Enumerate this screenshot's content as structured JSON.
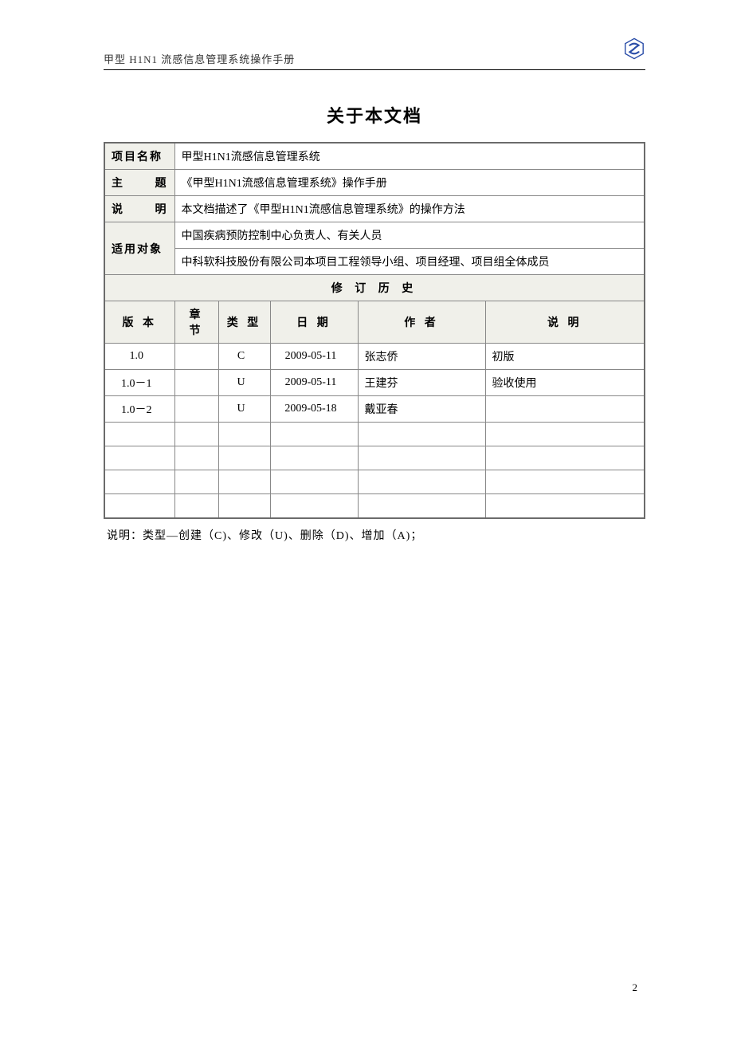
{
  "header": {
    "title": "甲型 H1N1 流感信息管理系统操作手册"
  },
  "doc_title": "关于本文档",
  "meta": {
    "project_name_label": "项目名称",
    "project_name": "甲型H1N1流感信息管理系统",
    "subject_label": "主　　题",
    "subject": "《甲型H1N1流感信息管理系统》操作手册",
    "description_label": "说　　明",
    "description": "本文档描述了《甲型H1N1流感信息管理系统》的操作方法",
    "audience_label": "适用对象",
    "audience_line1": "中国疾病预防控制中心负责人、有关人员",
    "audience_line2": "中科软科技股份有限公司本项目工程领导小组、项目经理、项目组全体成员"
  },
  "revision": {
    "title": "修 订 历 史",
    "columns": {
      "version": "版 本",
      "chapter": "章 节",
      "type": "类 型",
      "date": "日 期",
      "author": "作 者",
      "note": "说 明"
    },
    "rows": [
      {
        "version": "1.0",
        "chapter": "",
        "type": "C",
        "date": "2009-05-11",
        "author": "张志侨",
        "note": "初版"
      },
      {
        "version": "1.0－1",
        "chapter": "",
        "type": "U",
        "date": "2009-05-11",
        "author": "王建芬",
        "note": "验收使用"
      },
      {
        "version": "1.0－2",
        "chapter": "",
        "type": "U",
        "date": "2009-05-18",
        "author": "戴亚春",
        "note": ""
      },
      {
        "version": "",
        "chapter": "",
        "type": "",
        "date": "",
        "author": "",
        "note": ""
      },
      {
        "version": "",
        "chapter": "",
        "type": "",
        "date": "",
        "author": "",
        "note": ""
      },
      {
        "version": "",
        "chapter": "",
        "type": "",
        "date": "",
        "author": "",
        "note": ""
      },
      {
        "version": "",
        "chapter": "",
        "type": "",
        "date": "",
        "author": "",
        "note": ""
      }
    ]
  },
  "footnote": "说明：类型—创建（C)、修改（U)、删除（D)、增加（A)；",
  "page_number": "2"
}
